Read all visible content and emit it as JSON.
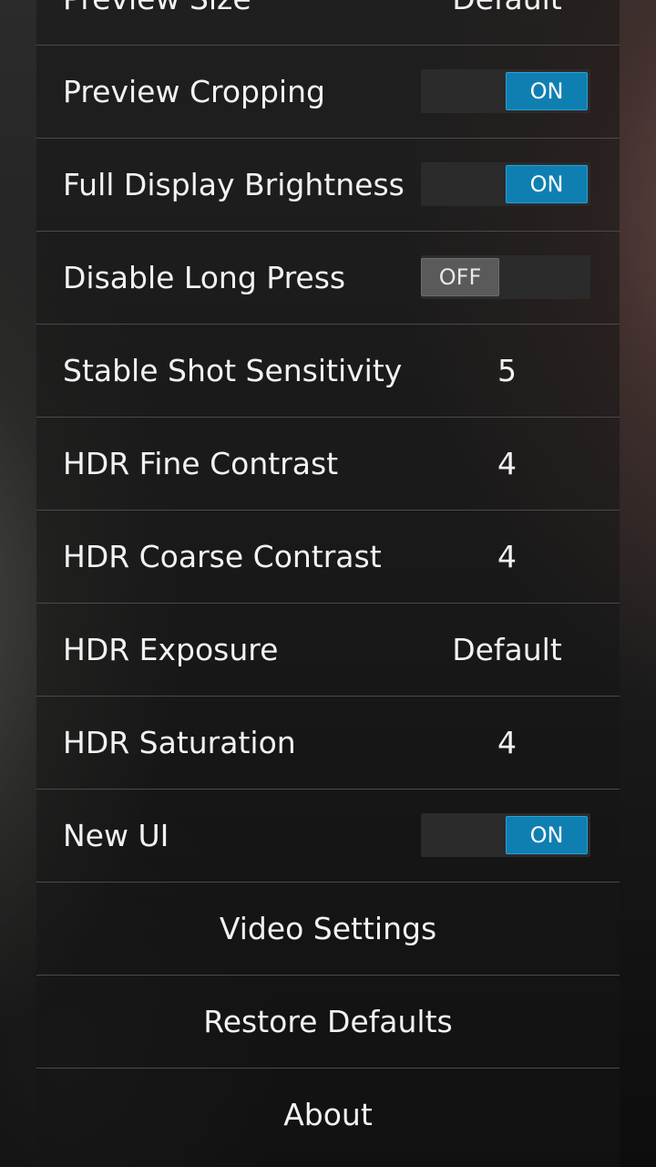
{
  "settings": {
    "rows": [
      {
        "label": "Preview Size",
        "value": "Default"
      },
      {
        "label": "Preview Cropping",
        "toggle": "ON"
      },
      {
        "label": "Full Display Brightness",
        "toggle": "ON"
      },
      {
        "label": "Disable Long Press",
        "toggle": "OFF"
      },
      {
        "label": "Stable Shot Sensitivity",
        "value": "5"
      },
      {
        "label": "HDR Fine Contrast",
        "value": "4"
      },
      {
        "label": "HDR Coarse Contrast",
        "value": "4"
      },
      {
        "label": "HDR Exposure",
        "value": "Default"
      },
      {
        "label": "HDR Saturation",
        "value": "4"
      },
      {
        "label": "New UI",
        "toggle": "ON"
      }
    ],
    "buttons": {
      "video_settings": "Video Settings",
      "restore_defaults": "Restore Defaults",
      "about": "About"
    }
  },
  "colors": {
    "toggle_on": "#0f7fb2",
    "toggle_off": "#5a5a5a",
    "divider": "#4a4a4a",
    "text": "#f2f2f2"
  }
}
